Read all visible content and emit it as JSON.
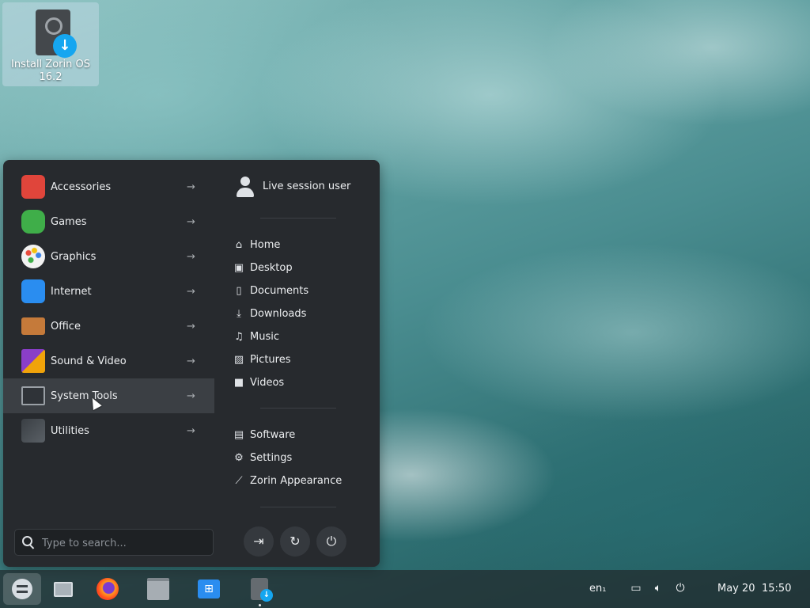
{
  "desktop": {
    "icons": [
      {
        "label": "Install Zorin OS 16.2"
      }
    ]
  },
  "menu": {
    "categories": [
      {
        "label": "Accessories",
        "icon": "accessories-icon",
        "color": "#e0453b"
      },
      {
        "label": "Games",
        "icon": "games-icon",
        "color": "#3fae49"
      },
      {
        "label": "Graphics",
        "icon": "graphics-icon",
        "color": "#f2f2f2"
      },
      {
        "label": "Internet",
        "icon": "internet-icon",
        "color": "#2a8df0"
      },
      {
        "label": "Office",
        "icon": "office-icon",
        "color": "#c57a3a"
      },
      {
        "label": "Sound & Video",
        "icon": "sound-video-icon",
        "color": "#8a3ec9"
      },
      {
        "label": "System Tools",
        "icon": "system-tools-icon",
        "color": "#6b7075"
      },
      {
        "label": "Utilities",
        "icon": "utilities-icon",
        "color": "#4a5056"
      }
    ],
    "active_category": "System Tools",
    "arrow": "→",
    "user": {
      "label": "Live session user"
    },
    "places": [
      {
        "label": "Home",
        "icon": "home-icon",
        "glyph": "⌂"
      },
      {
        "label": "Desktop",
        "icon": "desktop-folder-icon",
        "glyph": "▣"
      },
      {
        "label": "Documents",
        "icon": "documents-icon",
        "glyph": "▯"
      },
      {
        "label": "Downloads",
        "icon": "downloads-icon",
        "glyph": "⤓"
      },
      {
        "label": "Music",
        "icon": "music-icon",
        "glyph": "♫"
      },
      {
        "label": "Pictures",
        "icon": "pictures-icon",
        "glyph": "▨"
      },
      {
        "label": "Videos",
        "icon": "videos-icon",
        "glyph": "■"
      }
    ],
    "system": [
      {
        "label": "Software",
        "icon": "software-icon",
        "glyph": "▤"
      },
      {
        "label": "Settings",
        "icon": "settings-icon",
        "glyph": "⚙"
      },
      {
        "label": "Zorin Appearance",
        "icon": "appearance-icon",
        "glyph": "⟋"
      }
    ],
    "search": {
      "placeholder": "Type to search..."
    },
    "power_buttons": [
      {
        "name": "logout-button",
        "glyph": "⇥"
      },
      {
        "name": "restart-button",
        "glyph": "↻"
      },
      {
        "name": "power-off-button",
        "glyph": "⏻"
      }
    ]
  },
  "taskbar": {
    "keyboard_layout": "en₁",
    "date": "May 20",
    "time": "15:50",
    "accent": "#15a6f0"
  }
}
